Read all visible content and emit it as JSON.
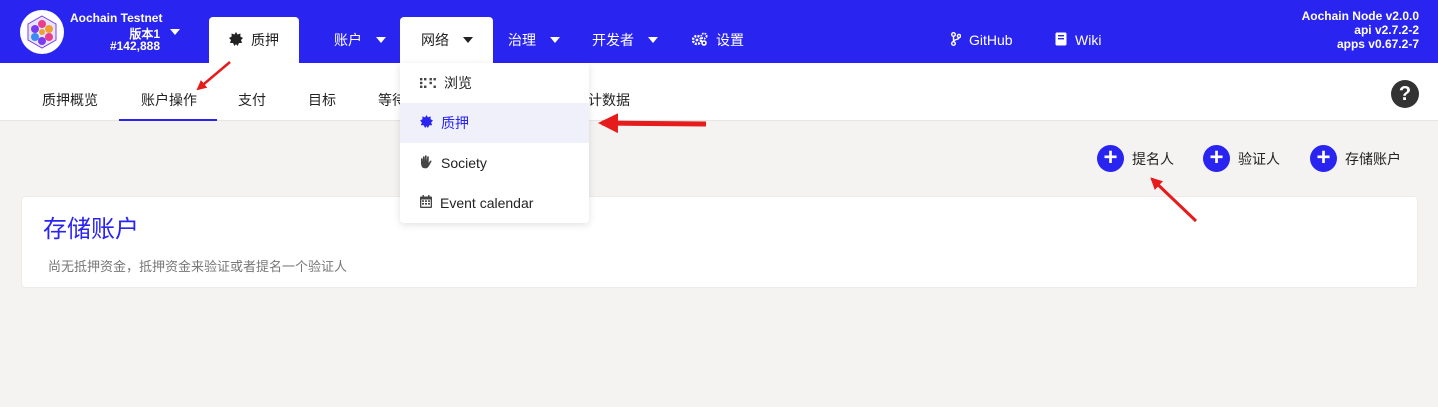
{
  "chain": {
    "name": "Aochain Testnet",
    "version": "版本1",
    "block": "#142,888"
  },
  "nav": {
    "staking": "质押",
    "accounts": "账户",
    "network": "网络",
    "governance": "治理",
    "developer": "开发者",
    "settings": "设置",
    "github": "GitHub",
    "wiki": "Wiki"
  },
  "node": {
    "line1": "Aochain Node v2.0.0",
    "line2": "api v2.7.2-2",
    "line3": "apps v0.67.2-7"
  },
  "subtabs": {
    "overview": "质押概览",
    "account_actions": "账户操作",
    "payouts": "支付",
    "targets": "目标",
    "waiting": "等待",
    "stats": "计数据"
  },
  "dropdown": {
    "explorer": "浏览",
    "staking": "质押",
    "society": "Society",
    "calendar": "Event calendar"
  },
  "actions": {
    "nominator": "提名人",
    "validator": "验证人",
    "stash": "存储账户"
  },
  "card": {
    "title": "存储账户",
    "description": "尚无抵押资金，抵押资金来验证或者提名一个验证人"
  },
  "colors": {
    "brand": "#2a24f0",
    "annotation": "#e61b1b",
    "page_bg": "#f5f3f1"
  }
}
